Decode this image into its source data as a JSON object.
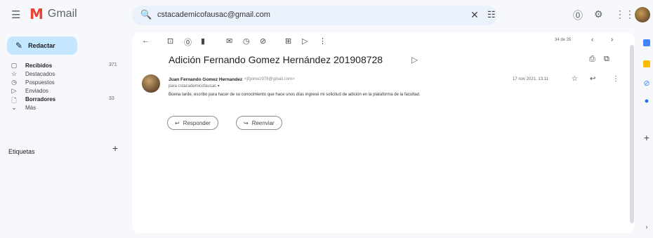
{
  "app": {
    "name": "Gmail"
  },
  "search": {
    "value": "cstacademicofausac@gmail.com"
  },
  "compose": {
    "label": "Redactar"
  },
  "nav": [
    {
      "name": "inbox",
      "icon": "▢",
      "label": "Recibidos",
      "count": "371",
      "bold": true
    },
    {
      "name": "starred",
      "icon": "☆",
      "label": "Destacados",
      "count": "",
      "bold": false
    },
    {
      "name": "snoozed",
      "icon": "◷",
      "label": "Pospuestos",
      "count": "",
      "bold": false
    },
    {
      "name": "sent",
      "icon": "▷",
      "label": "Enviados",
      "count": "",
      "bold": false
    },
    {
      "name": "drafts",
      "icon": "🗋",
      "label": "Borradores",
      "count": "33",
      "bold": true
    },
    {
      "name": "more",
      "icon": "⌄",
      "label": "Más",
      "count": "",
      "bold": false
    }
  ],
  "labels_section": {
    "title": "Etiquetas",
    "add": "+"
  },
  "toolbar": {
    "pager": "34 de 35"
  },
  "email": {
    "subject": "Adición Fernando Gomez Hernández 201908728",
    "sender_name": "Juan Fernando Gomez Hernandez",
    "sender_email": "<jfgomez978@gmail.com>",
    "to": "para cstacademicofausac ▾",
    "date": "17 nov 2021, 13:11",
    "body": "Buena tarde, escribo para hacer de su conocimiento que hace unos días ingresé mi solicitud de adición en la plataforma de la facultad."
  },
  "actions": {
    "reply": "Responder",
    "forward": "Reenviar"
  },
  "colors": {
    "accent": "#c2e7ff",
    "background": "#f6f8fc",
    "search_bg": "#eaf1fb"
  }
}
